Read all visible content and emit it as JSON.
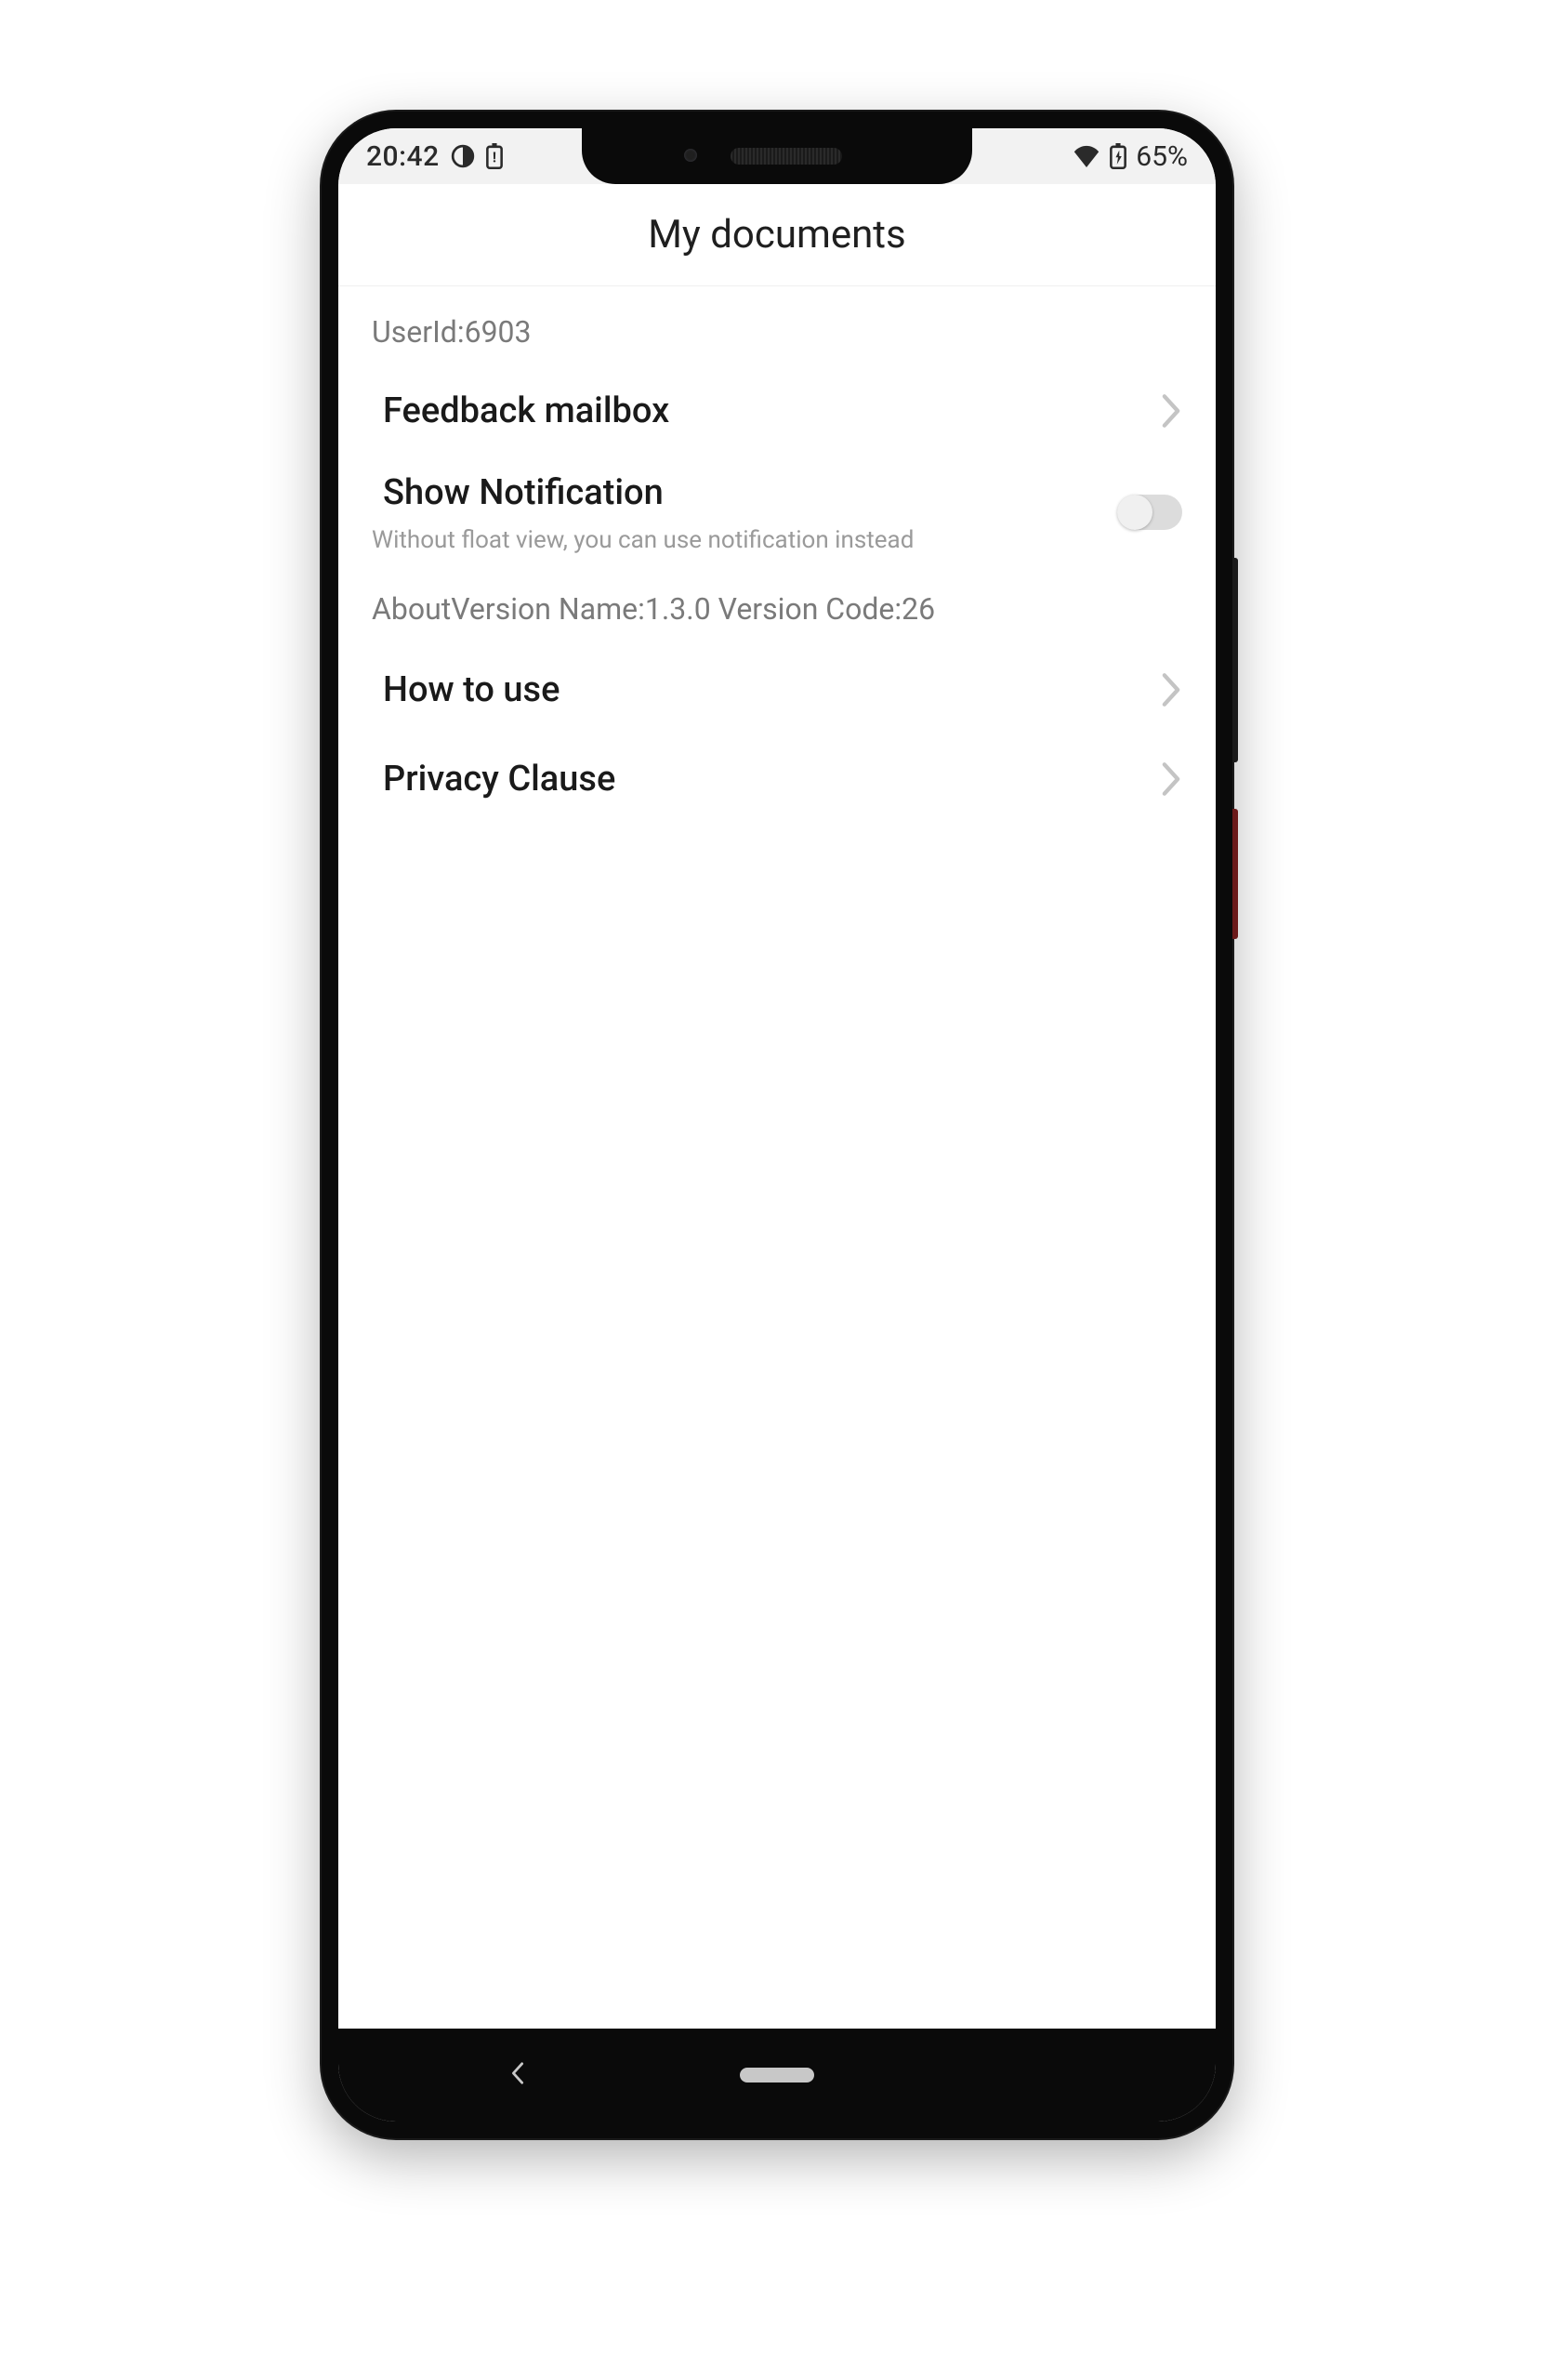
{
  "statusBar": {
    "time": "20:42",
    "batteryPercent": "65%"
  },
  "header": {
    "title": "My documents"
  },
  "userSection": {
    "label": "UserId:6903"
  },
  "rows": {
    "feedback": {
      "label": "Feedback mailbox"
    },
    "showNotification": {
      "label": "Show Notification",
      "description": "Without float view, you can use notification instead",
      "enabled": false
    },
    "howToUse": {
      "label": "How to use"
    },
    "privacy": {
      "label": "Privacy Clause"
    }
  },
  "about": {
    "text": "AboutVersion Name:1.3.0 Version Code:26"
  }
}
